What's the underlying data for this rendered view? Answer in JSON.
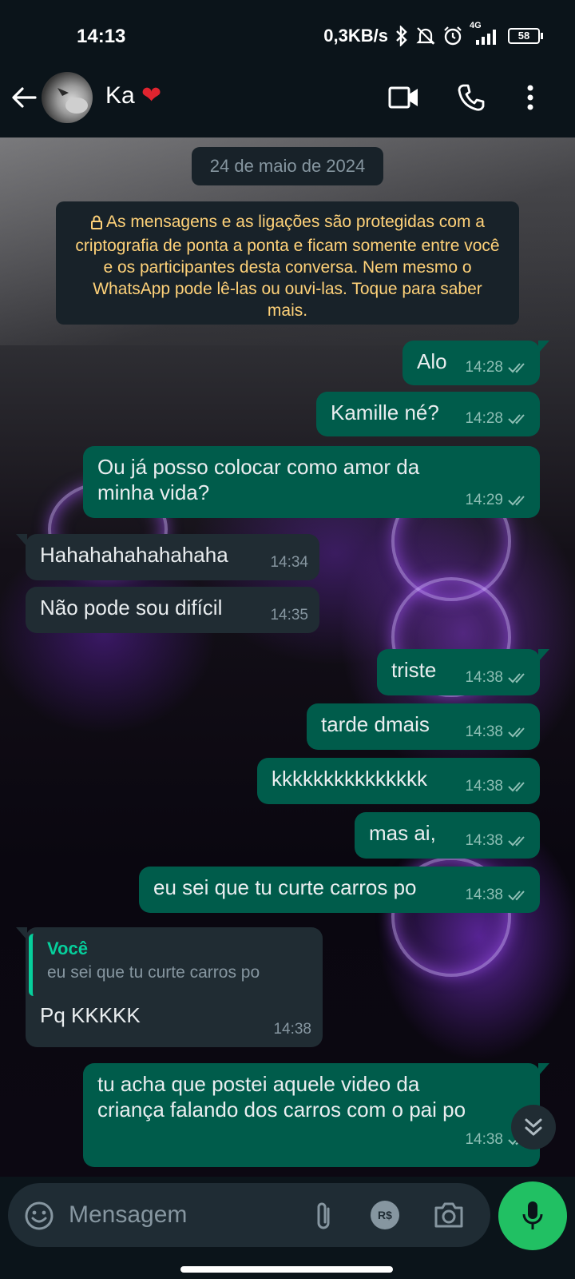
{
  "status_bar": {
    "time": "14:13",
    "net_speed": "0,3KB/s",
    "network": "4G",
    "battery": "58",
    "icons": [
      "bluetooth-icon",
      "mute-bell-icon",
      "alarm-icon",
      "signal-icon",
      "battery-icon"
    ]
  },
  "header": {
    "contact_name": "Ka",
    "contact_emoji": "❤",
    "icons": [
      "back-arrow-icon",
      "video-call-icon",
      "voice-call-icon",
      "more-options-icon"
    ]
  },
  "chat": {
    "date_chip": "24 de maio de 2024",
    "encryption_notice": "As mensagens e as ligações são protegidas com a criptografia de ponta a ponta e ficam somente entre você e os participantes desta conversa. Nem mesmo o WhatsApp pode lê-las ou ouvi-las. Toque para saber mais.",
    "messages": [
      {
        "direction": "out",
        "text": "Alo",
        "time": "14:28",
        "status": "read"
      },
      {
        "direction": "out",
        "text": "Kamille né?",
        "time": "14:28",
        "status": "read"
      },
      {
        "direction": "out",
        "text_line1": "Ou já posso colocar como amor da",
        "text_line2": "minha vida?",
        "time": "14:29",
        "status": "read"
      },
      {
        "direction": "in",
        "text": "Hahahahahahahaha",
        "time": "14:34"
      },
      {
        "direction": "in",
        "text": "Não pode sou difícil",
        "time": "14:35"
      },
      {
        "direction": "out",
        "text": "triste",
        "time": "14:38",
        "status": "read"
      },
      {
        "direction": "out",
        "text": "tarde dmais",
        "time": "14:38",
        "status": "read"
      },
      {
        "direction": "out",
        "text": "kkkkkkkkkkkkkkk",
        "time": "14:38",
        "status": "read"
      },
      {
        "direction": "out",
        "text": "mas ai,",
        "time": "14:38",
        "status": "read"
      },
      {
        "direction": "out",
        "text": "eu sei que tu curte carros po",
        "time": "14:38",
        "status": "read"
      },
      {
        "direction": "in",
        "quote_author": "Você",
        "quote_text": "eu sei que tu curte carros po",
        "text": "Pq KKKKK",
        "time": "14:38"
      },
      {
        "direction": "out",
        "text_line1": "tu acha que postei aquele video da",
        "text_line2": "criança falando dos carros com o pai po",
        "time": "14:38",
        "status": "read"
      }
    ]
  },
  "composer": {
    "placeholder": "Mensagem",
    "icons": [
      "emoji-icon",
      "attach-icon",
      "payment-icon",
      "camera-icon",
      "mic-icon"
    ],
    "payment_label": "R$"
  },
  "colors": {
    "outgoing_bubble": "#005c4b",
    "incoming_bubble": "#202c33",
    "accent_green": "#21c063",
    "quote_accent": "#06cf9c",
    "notice_text": "#ffd279"
  }
}
